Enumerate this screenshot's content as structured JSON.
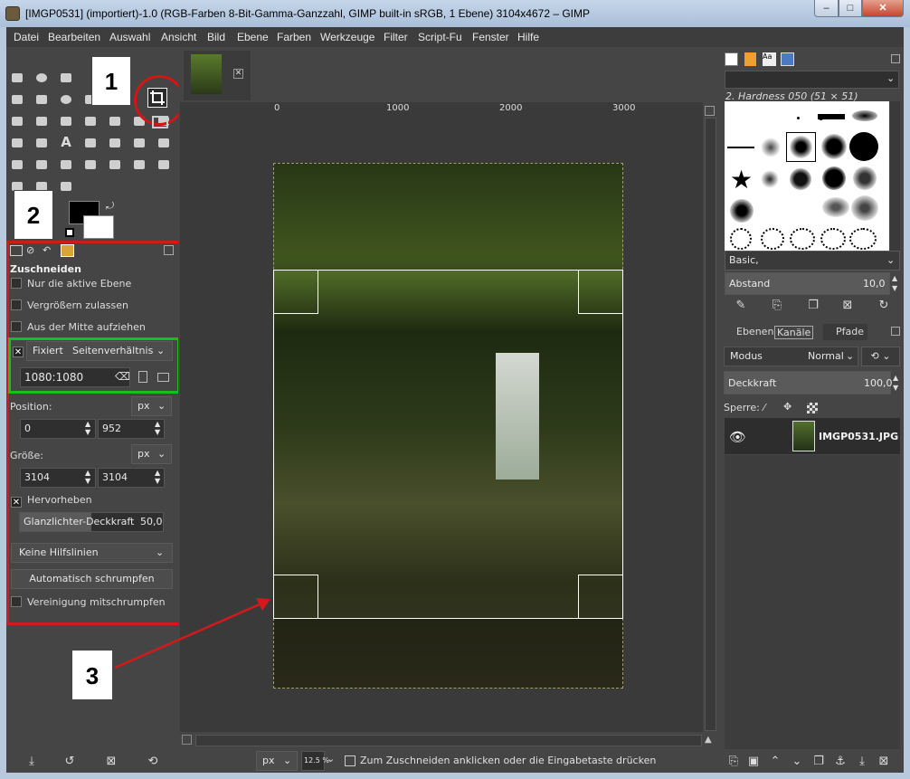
{
  "window": {
    "title": "[IMGP0531] (importiert)-1.0 (RGB-Farben 8-Bit-Gamma-Ganzzahl, GIMP built-in sRGB, 1 Ebene) 3104x4672 – GIMP",
    "minimize": "–",
    "maximize": "□",
    "close": "✕"
  },
  "menu": [
    "Datei",
    "Bearbeiten",
    "Auswahl",
    "Ansicht",
    "Bild",
    "Ebene",
    "Farben",
    "Werkzeuge",
    "Filter",
    "Script-Fu",
    "Fenster",
    "Hilfe"
  ],
  "callouts": {
    "one": "1",
    "two": "2",
    "three": "3"
  },
  "tool_options": {
    "title": "Zuschneiden",
    "only_active_layer": "Nur die aktive Ebene",
    "allow_grow": "Vergrößern zulassen",
    "from_center": "Aus der Mitte aufziehen",
    "fixed_label": "Fixiert",
    "fixed_mode": "Seitenverhältnis",
    "aspect_value": "1080:1080",
    "position_label": "Position:",
    "position_unit": "px",
    "pos_x": "0",
    "pos_y": "952",
    "size_label": "Größe:",
    "size_unit": "px",
    "size_w": "3104",
    "size_h": "3104",
    "highlight_label": "Hervorheben",
    "highlight_opacity_label": "Glanzlichter-Deckkraft",
    "highlight_opacity_value": "50,0",
    "guides": "Keine Hilfslinien",
    "auto_shrink": "Automatisch schrumpfen",
    "shrink_merged": "Vereinigung mitschrumpfen"
  },
  "rulers": {
    "h": [
      "0",
      "1000",
      "2000",
      "3000"
    ],
    "v": [
      "0",
      "1000",
      "2000",
      "3000",
      "4000"
    ]
  },
  "status": {
    "unit": "px",
    "zoom": "12.5 %",
    "message": "Zum Zuschneiden anklicken oder die Eingabetaste drücken"
  },
  "brushes": {
    "current": "2. Hardness 050 (51 × 51)",
    "preset": "Basic,",
    "spacing_label": "Abstand",
    "spacing_value": "10,0"
  },
  "layers": {
    "tabs": [
      "Ebenen",
      "Kanäle",
      "Pfade"
    ],
    "mode_label": "Modus",
    "mode_value": "Normal",
    "opacity_label": "Deckkraft",
    "opacity_value": "100,0",
    "lock_label": "Sperre:",
    "layer_name": "IMGP0531.JPG"
  },
  "colors": {
    "callout_red": "#d2191b",
    "highlight_green": "#14c020"
  }
}
